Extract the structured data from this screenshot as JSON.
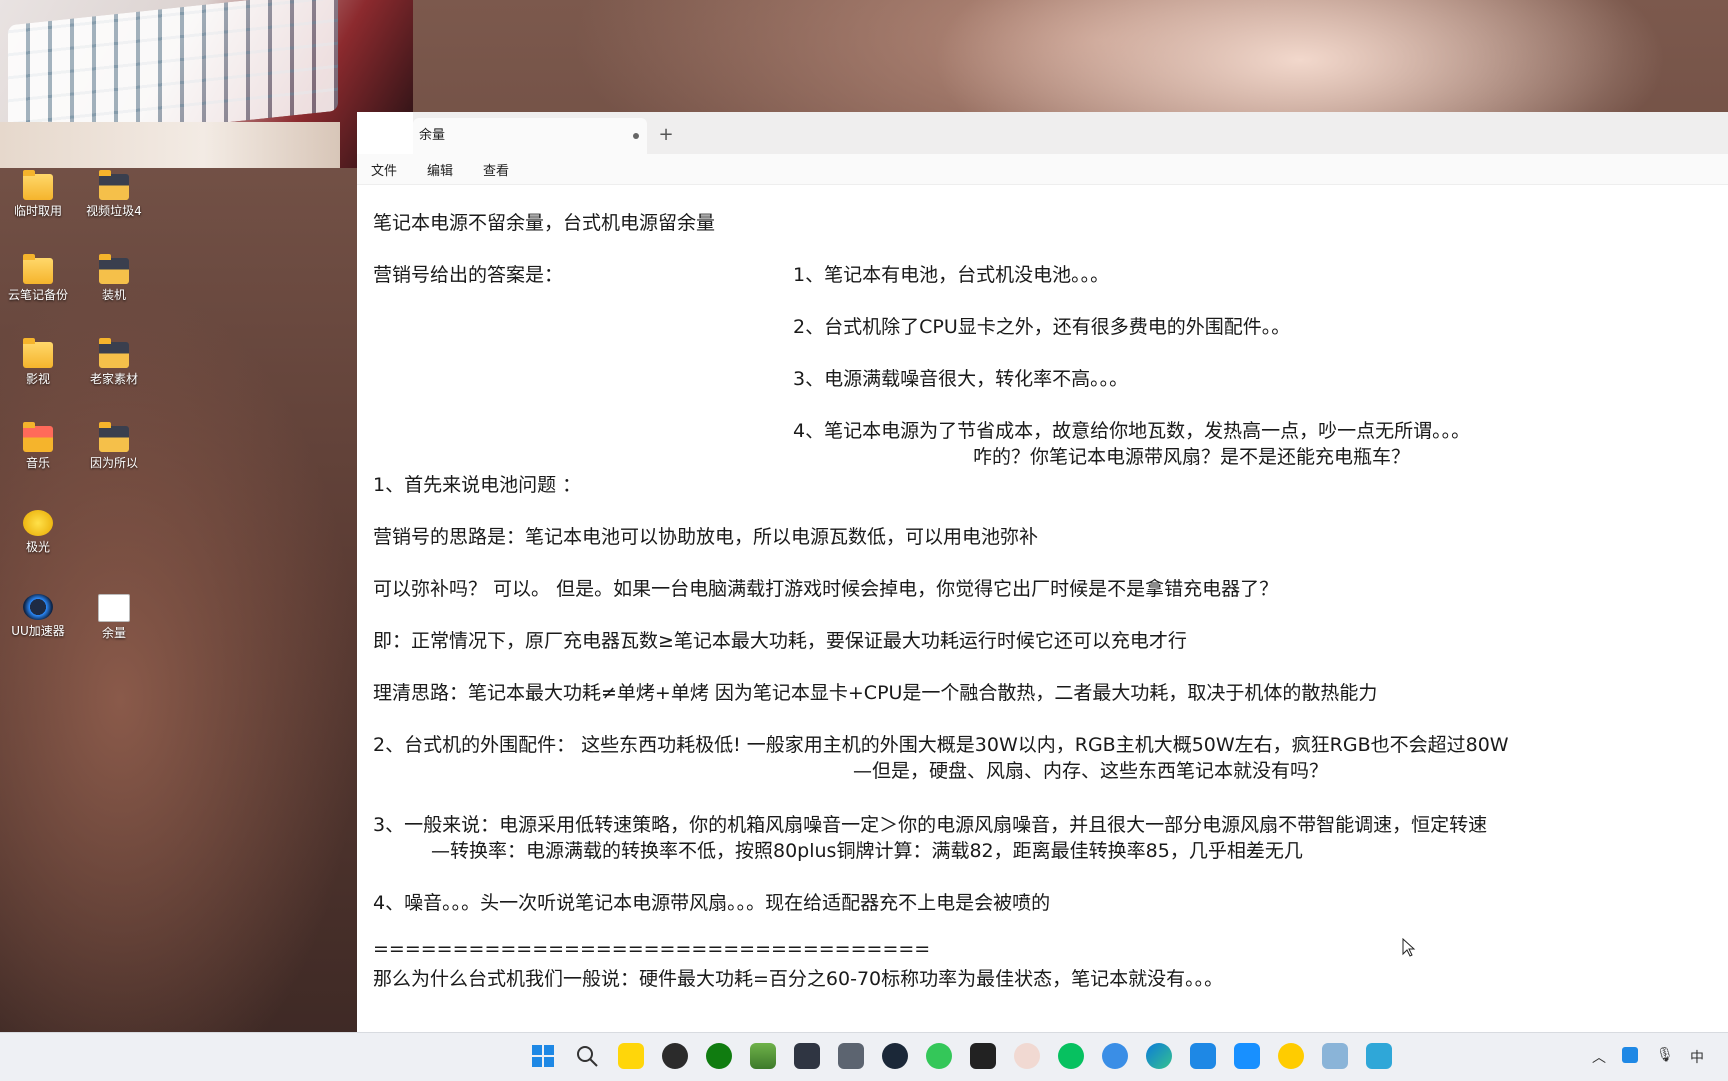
{
  "desktop": {
    "icons": [
      {
        "label": "临时取用",
        "type": "folder"
      },
      {
        "label": "视频垃圾4",
        "type": "folder-dark"
      },
      {
        "label": "云笔记备份",
        "type": "folder"
      },
      {
        "label": "装机",
        "type": "folder-dark"
      },
      {
        "label": "影视",
        "type": "folder"
      },
      {
        "label": "老家素材",
        "type": "folder-dark"
      },
      {
        "label": "音乐",
        "type": "folder-red"
      },
      {
        "label": "因为所以",
        "type": "folder-dark"
      },
      {
        "label": "极光",
        "type": "app"
      },
      {
        "label": "UU加速器",
        "type": "app"
      },
      {
        "label": "余量",
        "type": "text-file"
      }
    ]
  },
  "notepad": {
    "tab_title": "余量",
    "tab_unsaved": true,
    "new_tab_label": "+",
    "menu": [
      "文件",
      "编辑",
      "查看"
    ],
    "lines": [
      "笔记本电源不留余量，台式机电源留余量",
      "营销号给出的答案是：",
      "1、笔记本有电池，台式机没电池。。。",
      "2、台式机除了CPU显卡之外，还有很多费电的外围配件。。",
      "3、电源满载噪音很大，转化率不高。。。",
      "4、笔记本电源为了节省成本，故意给你地瓦数，发热高一点，吵一点无所谓。。。",
      "咋的？你笔记本电源带风扇？是不是还能充电瓶车？",
      "1、首先来说电池问题 ：",
      "营销号的思路是：笔记本电池可以协助放电，所以电源瓦数低，可以用电池弥补",
      "可以弥补吗？  可以。  但是。如果一台电脑满载打游戏时候会掉电，你觉得它出厂时候是不是拿错充电器了？",
      "即：正常情况下，原厂充电器瓦数≥笔记本最大功耗，要保证最大功耗运行时候它还可以充电才行",
      "理清思路：笔记本最大功耗≠单烤+单烤     因为笔记本显卡+CPU是一个融合散热，二者最大功耗，取决于机体的散热能力",
      "2、台式机的外围配件：  这些东西功耗极低!  一般家用主机的外围大概是30W以内，RGB主机大概50W左右，疯狂RGB也不会超过80W",
      "—但是，硬盘、风扇、内存、这些东西笔记本就没有吗？",
      "3、一般来说：电源采用低转速策略，你的机箱风扇噪音一定＞你的电源风扇噪音，并且很大一部分电源风扇不带智能调速，恒定转速",
      "—转换率：电源满载的转换率不低，按照80plus铜牌计算：满载82，距离最佳转换率85，几乎相差无几",
      "4、噪音。。。头一次听说笔记本电源带风扇。。。现在给适配器充不上电是会被喷的",
      "===================================",
      "那么为什么台式机我们一般说：硬件最大功耗=百分之60-70标称功率为最佳状态，笔记本就没有。。。"
    ]
  },
  "taskbar": {
    "apps": [
      "start",
      "search",
      "notes",
      "app-dragon",
      "xbox",
      "gallery",
      "camera",
      "calculator",
      "steam",
      "wechat-green",
      "sogou",
      "anime",
      "wechat",
      "edge-dev",
      "edge",
      "vpn",
      "feishu",
      "jiguang",
      "vscode",
      "notepad"
    ],
    "tray": [
      "chevron-up",
      "bluetooth",
      "mic",
      "input-method"
    ],
    "ime_label": "中"
  }
}
